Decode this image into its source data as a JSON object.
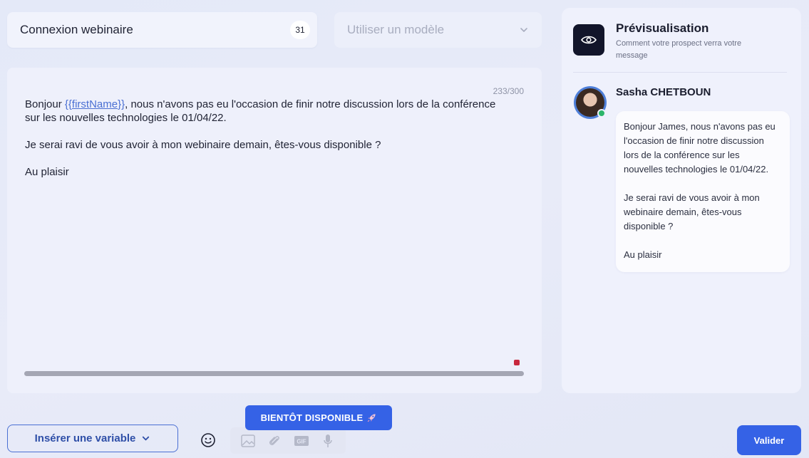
{
  "campaign": {
    "title_value": "Connexion webinaire",
    "title_char_count": "31"
  },
  "template": {
    "placeholder": "Utiliser un modèle"
  },
  "editor": {
    "char_counter": "233/300",
    "greeting_prefix": "Bonjour ",
    "var_open": "{{",
    "var_name": "firstName",
    "var_close": "}}",
    "line1_rest": ", nous n'avons pas eu l'occasion de finir notre discussion lors de la conférence sur les nouvelles technologies le 01/04/22.",
    "paragraph2": "Je serai ravi de vous avoir à mon webinaire demain, êtes-vous disponible ?",
    "paragraph3": "Au plaisir"
  },
  "preview": {
    "title": "Prévisualisation",
    "subtitle": "Comment votre prospect verra votre message",
    "sender_name": "Sasha CHETBOUN",
    "bubble_p1": "Bonjour James, nous n'avons pas eu l'occasion de finir notre discussion lors de la conférence sur les nouvelles technologies le 01/04/22.",
    "bubble_p2": "Je serai ravi de vous avoir à mon webinaire demain, êtes-vous disponible ?",
    "bubble_p3": "Au plaisir"
  },
  "toolbar": {
    "insert_variable_label": "Insérer une variable",
    "coming_soon_label": "BIENTÔT DISPONIBLE",
    "validate_label": "Valider",
    "icons": [
      "emoji-icon",
      "image-icon",
      "paperclip-icon",
      "gif-icon",
      "microphone-icon"
    ]
  },
  "colors": {
    "accent": "#3562e6",
    "online": "#2cb56a",
    "variable": "#4a6fd3"
  }
}
